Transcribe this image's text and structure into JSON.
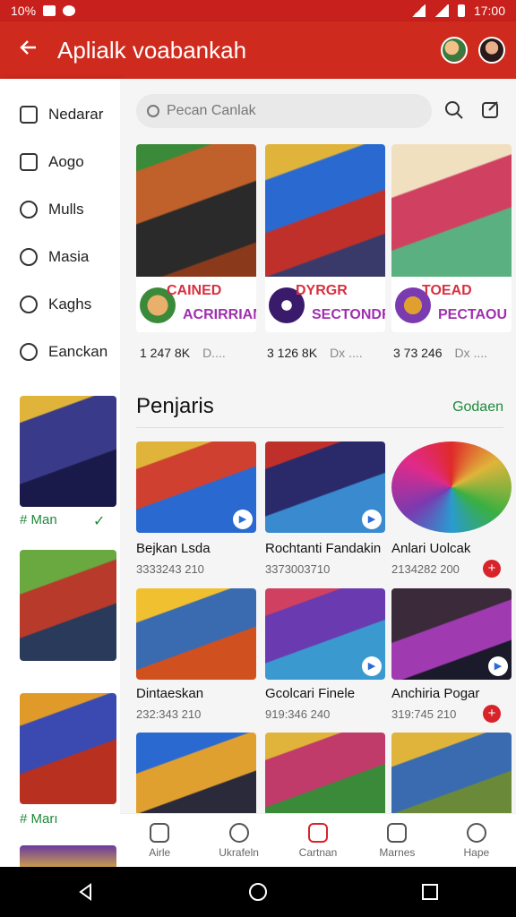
{
  "status_bar": {
    "battery": "10%",
    "time": "17:00"
  },
  "app_bar": {
    "title": "Aplialk voabankah",
    "back_icon": "arrow-left-icon"
  },
  "sidebar": {
    "items": [
      {
        "label": "Nedarar",
        "icon": "square-icon"
      },
      {
        "label": "Aogo",
        "icon": "box-icon"
      },
      {
        "label": "Mulls",
        "icon": "search-icon"
      },
      {
        "label": "Masia",
        "icon": "chat-icon"
      },
      {
        "label": "Kaghs",
        "icon": "clock-icon"
      },
      {
        "label": "Eanckan",
        "icon": "history-icon"
      }
    ],
    "cards": [
      {
        "label": "# Man",
        "has_check": true
      },
      {
        "label": "",
        "has_check": false
      },
      {
        "label": "# Marı",
        "has_check": false
      }
    ]
  },
  "search": {
    "placeholder": "Pecan Canlak"
  },
  "featured": [
    {
      "line1": "CAINED",
      "line2": "ACRIRRIAN",
      "stat": "1 247 8K",
      "dim": "D...."
    },
    {
      "line1": "DYRGR",
      "line2": "SECTONDR",
      "stat": "3 126 8K",
      "dim": "Dx ...."
    },
    {
      "line1": "TOEAD",
      "line2": "PECTAOU",
      "stat": "3 73 246",
      "dim": "Dx ...."
    }
  ],
  "section": {
    "title": "Penjaris",
    "link": "Godaen"
  },
  "games": [
    {
      "name": "Bejkan Lsda",
      "sub": "3333243 210"
    },
    {
      "name": "Rochtanti Fandakin",
      "sub": "3373003710"
    },
    {
      "name": "Anlari Uolcak",
      "sub": "2134282 200"
    },
    {
      "name": "Dintaeskan",
      "sub": "232:343 210"
    },
    {
      "name": "Gcolcari Finele",
      "sub": "919:346 240"
    },
    {
      "name": "Anchiria Pogar",
      "sub": "319:745 210"
    }
  ],
  "bottom_nav": [
    {
      "label": "Airle"
    },
    {
      "label": "Ukrafeln"
    },
    {
      "label": "Cartnan"
    },
    {
      "label": "Marnes"
    },
    {
      "label": "Hape"
    }
  ]
}
